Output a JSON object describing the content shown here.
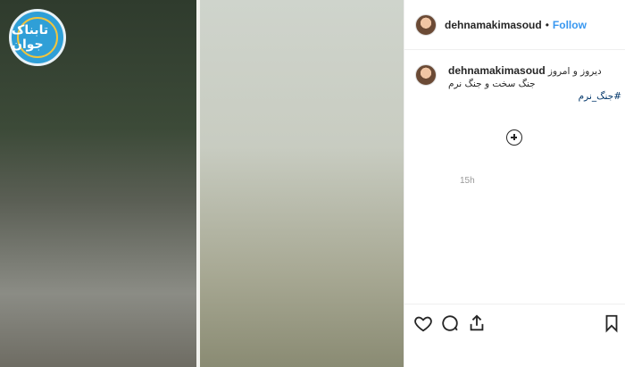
{
  "post": {
    "username": "dehnamakimasoud",
    "follow_label": "Follow",
    "separator": "•"
  },
  "media": {
    "watermark_text": "تابناک جوان",
    "accent_color": "#2f9fd7"
  },
  "caption": {
    "username": "dehnamakimasoud",
    "line1": "دیروز و امروز",
    "line2": "جنگ سخت و جنگ نرم",
    "hashtag": "#جنگ_نرم",
    "time": "15h"
  },
  "icons": {
    "like": "heart-icon",
    "comment": "comment-icon",
    "share": "share-icon",
    "save": "bookmark-icon",
    "load_more": "plus-circle-icon"
  }
}
